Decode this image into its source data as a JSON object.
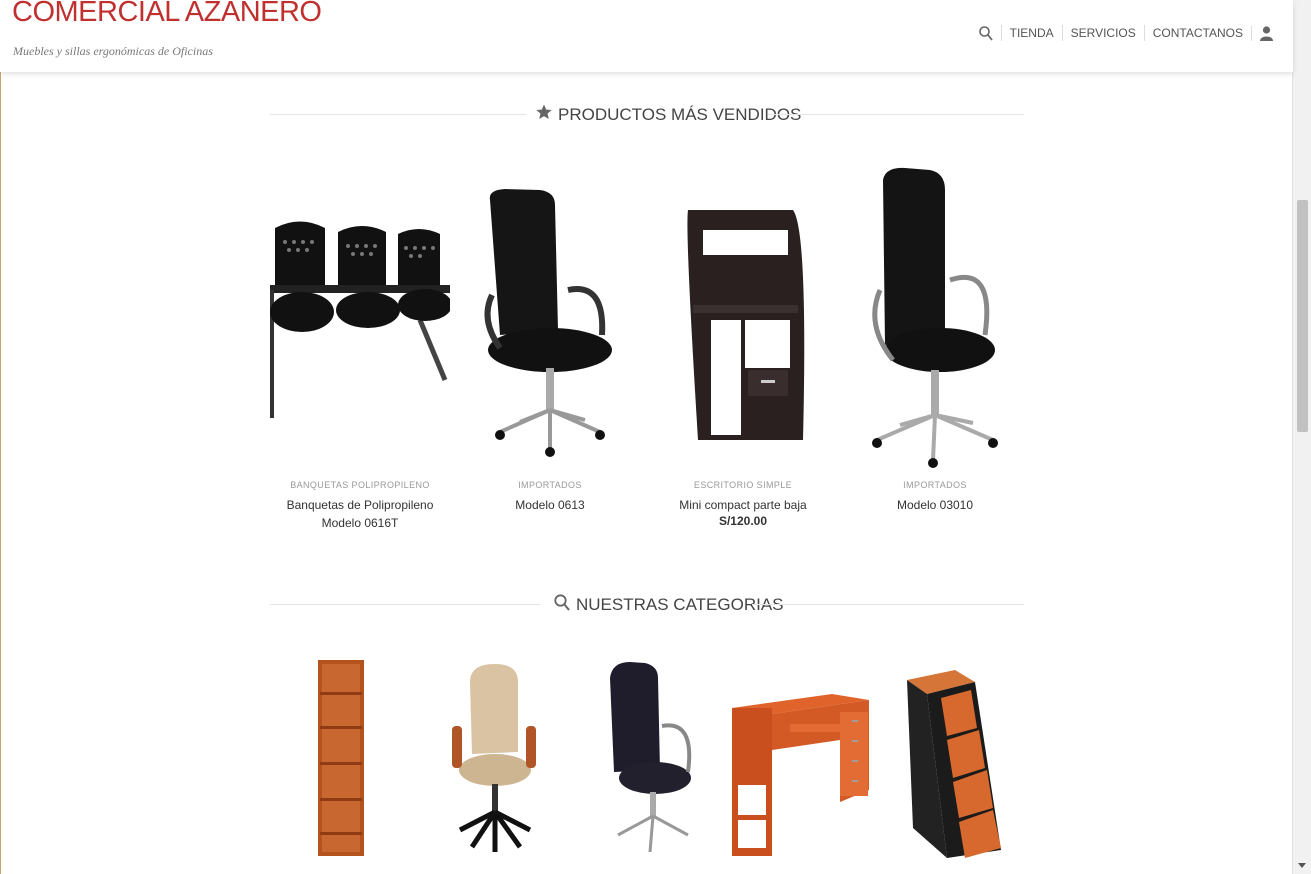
{
  "site": {
    "title": "COMERCIAL AZAÑERO",
    "tagline": "Muebles y sillas ergonómicas de Oficinas"
  },
  "nav": {
    "items": [
      "TIENDA",
      "SERVICIOS",
      "CONTACTANOS"
    ],
    "search_icon": "search-icon",
    "account_icon": "user-icon"
  },
  "sections": {
    "best_sellers": "PRODUCTOS MÁS VENDIDOS",
    "categories": "NUESTRAS CATEGORIAS"
  },
  "products": [
    {
      "category": "BANQUETAS POLIPROPILENO",
      "name": "Banquetas de Polipropileno Modelo 0616T",
      "price": ""
    },
    {
      "category": "IMPORTADOS",
      "name": "Modelo 0613",
      "price": ""
    },
    {
      "category": "ESCRITORIO SIMPLE",
      "name": "Mini compact parte baja",
      "price": "S/120.00"
    },
    {
      "category": "IMPORTADOS",
      "name": "Modelo 03010",
      "price": ""
    }
  ],
  "colors": {
    "brand": "#c0302f",
    "text": "#333333",
    "muted": "#999999"
  }
}
